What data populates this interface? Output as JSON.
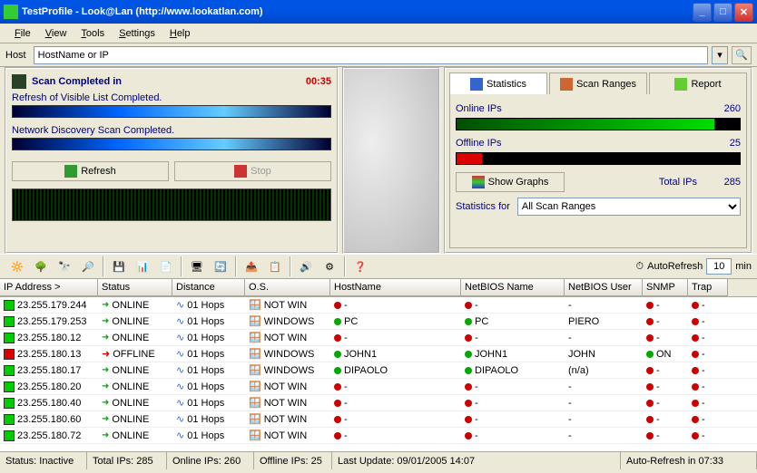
{
  "window": {
    "title": "TestProfile - Look@Lan (http://www.lookatlan.com)"
  },
  "menu": {
    "file": "File",
    "view": "View",
    "tools": "Tools",
    "settings": "Settings",
    "help": "Help"
  },
  "host": {
    "label": "Host",
    "value": "HostName or IP"
  },
  "scan": {
    "title": "Scan Completed in",
    "time": "00:35",
    "refresh_txt": "Refresh of Visible List Completed.",
    "network_txt": "Network Discovery Scan Completed.",
    "refresh_btn": "Refresh",
    "stop_btn": "Stop"
  },
  "tabs": {
    "stats": "Statistics",
    "ranges": "Scan Ranges",
    "report": "Report"
  },
  "stats": {
    "online_label": "Online IPs",
    "online_val": "260",
    "offline_label": "Offline IPs",
    "offline_val": "25",
    "show_graphs": "Show Graphs",
    "total_label": "Total IPs",
    "total_val": "285",
    "stats_for": "Statistics for",
    "range_sel": "All Scan Ranges"
  },
  "chart_data": [
    {
      "type": "bar",
      "title": "Online IPs",
      "categories": [
        "Online",
        "Other"
      ],
      "values": [
        260,
        25
      ],
      "colors": [
        "#00aa00",
        "#000000"
      ],
      "xlabel": "",
      "ylabel": "",
      "ylim": [
        0,
        285
      ]
    },
    {
      "type": "bar",
      "title": "Offline IPs",
      "categories": [
        "Offline",
        "Other"
      ],
      "values": [
        25,
        260
      ],
      "colors": [
        "#cc0000",
        "#000000"
      ],
      "xlabel": "",
      "ylabel": "",
      "ylim": [
        0,
        285
      ]
    }
  ],
  "autorefresh": {
    "label": "AutoRefresh",
    "value": "10",
    "unit": "min"
  },
  "grid": {
    "headers": {
      "ip": "IP Address >",
      "status": "Status",
      "dist": "Distance",
      "os": "O.S.",
      "hn": "HostName",
      "nb": "NetBIOS Name",
      "nu": "NetBIOS User",
      "snmp": "SNMP",
      "trap": "Trap"
    },
    "rows": [
      {
        "ip": "23.255.179.244",
        "status": "ONLINE",
        "offline": false,
        "hops": "01 Hops",
        "os": "NOT WIN",
        "hn": "-",
        "nb": "-",
        "nu": "-",
        "snmp": "-",
        "trap": "-"
      },
      {
        "ip": "23.255.179.253",
        "status": "ONLINE",
        "offline": false,
        "hops": "01 Hops",
        "os": "WINDOWS",
        "hn": "PC",
        "nb": "PC",
        "nu": "PIERO",
        "snmp": "-",
        "trap": "-"
      },
      {
        "ip": "23.255.180.12",
        "status": "ONLINE",
        "offline": false,
        "hops": "01 Hops",
        "os": "NOT WIN",
        "hn": "-",
        "nb": "-",
        "nu": "-",
        "snmp": "-",
        "trap": "-"
      },
      {
        "ip": "23.255.180.13",
        "status": "OFFLINE",
        "offline": true,
        "hops": "01 Hops",
        "os": "WINDOWS",
        "hn": "JOHN1",
        "nb": "JOHN1",
        "nu": "JOHN",
        "snmp": "ON",
        "trap": "-"
      },
      {
        "ip": "23.255.180.17",
        "status": "ONLINE",
        "offline": false,
        "hops": "01 Hops",
        "os": "WINDOWS",
        "hn": "DIPAOLO",
        "nb": "DIPAOLO",
        "nu": "(n/a)",
        "snmp": "-",
        "trap": "-"
      },
      {
        "ip": "23.255.180.20",
        "status": "ONLINE",
        "offline": false,
        "hops": "01 Hops",
        "os": "NOT WIN",
        "hn": "-",
        "nb": "-",
        "nu": "-",
        "snmp": "-",
        "trap": "-"
      },
      {
        "ip": "23.255.180.40",
        "status": "ONLINE",
        "offline": false,
        "hops": "01 Hops",
        "os": "NOT WIN",
        "hn": "-",
        "nb": "-",
        "nu": "-",
        "snmp": "-",
        "trap": "-"
      },
      {
        "ip": "23.255.180.60",
        "status": "ONLINE",
        "offline": false,
        "hops": "01 Hops",
        "os": "NOT WIN",
        "hn": "-",
        "nb": "-",
        "nu": "-",
        "snmp": "-",
        "trap": "-"
      },
      {
        "ip": "23.255.180.72",
        "status": "ONLINE",
        "offline": false,
        "hops": "01 Hops",
        "os": "NOT WIN",
        "hn": "-",
        "nb": "-",
        "nu": "-",
        "snmp": "-",
        "trap": "-"
      }
    ]
  },
  "statusbar": {
    "status": "Status: Inactive",
    "total": "Total IPs: 285",
    "online": "Online IPs: 260",
    "offline": "Offline IPs: 25",
    "update": "Last Update: 09/01/2005 14:07",
    "auto": "Auto-Refresh in 07:33"
  }
}
